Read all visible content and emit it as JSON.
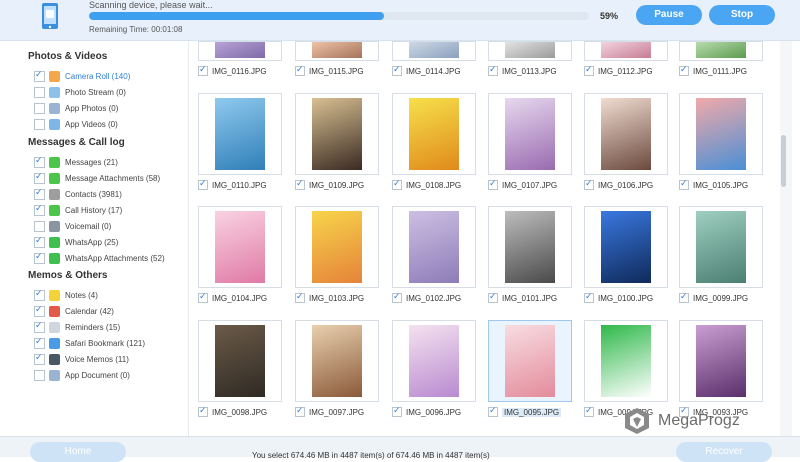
{
  "scan": {
    "status": "Scanning device, please wait...",
    "remaining": "Remaining Time: 00:01:08",
    "percent_text": "59%",
    "progress": 0.59,
    "pause_label": "Pause",
    "stop_label": "Stop"
  },
  "sidebar": {
    "sections": [
      {
        "title": "Photos & Videos",
        "items": [
          {
            "label": "Camera Roll (140)",
            "checked": true,
            "selected": true,
            "icon": "camera-roll-icon",
            "color": "#f3a64a"
          },
          {
            "label": "Photo Stream (0)",
            "checked": false,
            "icon": "photo-stream-icon",
            "color": "#8dc0ea"
          },
          {
            "label": "App Photos (0)",
            "checked": false,
            "icon": "app-photos-icon",
            "color": "#9ab3d3"
          },
          {
            "label": "App Videos (0)",
            "checked": false,
            "icon": "app-videos-icon",
            "color": "#7fb6e8"
          }
        ]
      },
      {
        "title": "Messages & Call log",
        "items": [
          {
            "label": "Messages (21)",
            "checked": true,
            "icon": "messages-icon",
            "color": "#4cc64a"
          },
          {
            "label": "Message Attachments (58)",
            "checked": true,
            "icon": "attachments-icon",
            "color": "#4cc64a"
          },
          {
            "label": "Contacts (3981)",
            "checked": true,
            "icon": "contacts-icon",
            "color": "#9e9e9e"
          },
          {
            "label": "Call History (17)",
            "checked": true,
            "icon": "phone-icon",
            "color": "#4cc64a"
          },
          {
            "label": "Voicemail (0)",
            "checked": false,
            "icon": "voicemail-icon",
            "color": "#8b95a1"
          },
          {
            "label": "WhatsApp (25)",
            "checked": true,
            "icon": "whatsapp-icon",
            "color": "#3fbf4f"
          },
          {
            "label": "WhatsApp Attachments (52)",
            "checked": true,
            "icon": "whatsapp-attachments-icon",
            "color": "#3fbf4f"
          }
        ]
      },
      {
        "title": "Memos & Others",
        "items": [
          {
            "label": "Notes (4)",
            "checked": true,
            "icon": "notes-icon",
            "color": "#f4d23a"
          },
          {
            "label": "Calendar (42)",
            "checked": true,
            "icon": "calendar-icon",
            "color": "#e45a4a"
          },
          {
            "label": "Reminders (15)",
            "checked": true,
            "icon": "reminders-icon",
            "color": "#cfd6de"
          },
          {
            "label": "Safari Bookmark (121)",
            "checked": true,
            "icon": "safari-icon",
            "color": "#4a9be6"
          },
          {
            "label": "Voice Memos (11)",
            "checked": true,
            "icon": "voice-memos-icon",
            "color": "#4a5866"
          },
          {
            "label": "App Document (0)",
            "checked": false,
            "icon": "app-document-icon",
            "color": "#9ab3d3"
          }
        ]
      }
    ]
  },
  "grid": {
    "rows": [
      [
        "IMG_0116.JPG",
        "IMG_0115.JPG",
        "IMG_0114.JPG",
        "IMG_0113.JPG",
        "IMG_0112.JPG",
        "IMG_0111.JPG"
      ],
      [
        "IMG_0110.JPG",
        "IMG_0109.JPG",
        "IMG_0108.JPG",
        "IMG_0107.JPG",
        "IMG_0106.JPG",
        "IMG_0105.JPG"
      ],
      [
        "IMG_0104.JPG",
        "IMG_0103.JPG",
        "IMG_0102.JPG",
        "IMG_0101.JPG",
        "IMG_0100.JPG",
        "IMG_0099.JPG"
      ],
      [
        "IMG_0098.JPG",
        "IMG_0097.JPG",
        "IMG_0096.JPG",
        "IMG_0095.JPG",
        "IMG_0094.JPG",
        "IMG_0093.JPG"
      ]
    ],
    "selected_file": "IMG_0095.JPG"
  },
  "bottom": {
    "home_label": "Home",
    "recover_label": "Recover",
    "status": "You select 674.46 MB in 4487 item(s) of 674.46 MB in 4487 item(s)"
  },
  "watermark": {
    "text": "MegaProgz"
  }
}
